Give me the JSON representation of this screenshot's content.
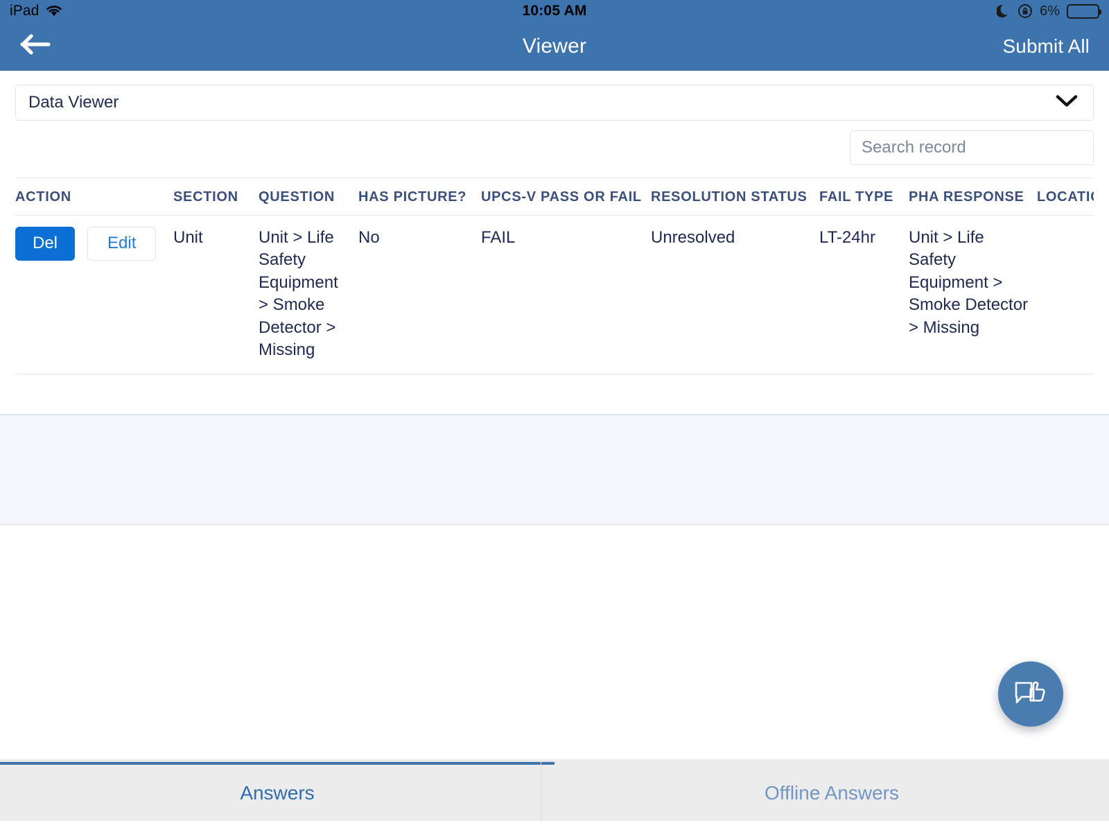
{
  "status_bar": {
    "device_label": "iPad",
    "wifi_icon": "wifi-icon",
    "time": "10:05 AM",
    "dnd_icon": "moon-icon",
    "rotation_lock_icon": "rotation-lock-icon",
    "battery_percent": "6%",
    "battery_level": 6,
    "battery_color": "#f9553f"
  },
  "nav_bar": {
    "back_icon": "arrow-left-icon",
    "title": "Viewer",
    "action_label": "Submit All",
    "background_color": "#3d74ad"
  },
  "viewer_select": {
    "value": "Data Viewer",
    "chevron_icon": "chevron-down-icon"
  },
  "search": {
    "value": "",
    "placeholder": "Search record"
  },
  "table": {
    "columns": [
      "ACTION",
      "SECTION",
      "QUESTION",
      "HAS PICTURE?",
      "UPCS-V PASS OR FAIL",
      "RESOLUTION STATUS",
      "FAIL TYPE",
      "PHA RESPONSE",
      "LOCATION"
    ],
    "rows": [
      {
        "delete_label": "Del",
        "edit_label": "Edit",
        "section": "Unit",
        "question": "Unit > Life Safety Equipment > Smoke Detector > Missing",
        "has_picture": "No",
        "upcsv_pass_or_fail": "FAIL",
        "resolution_status": "Unresolved",
        "fail_type": "LT-24hr",
        "pha_response": "Unit > Life Safety Equipment > Smoke Detector > Missing",
        "location": ""
      }
    ]
  },
  "fab": {
    "icon": "feedback-thumbs-up-icon",
    "color": "#4a7cb0"
  },
  "tab_bar": {
    "tabs": [
      {
        "label": "Answers",
        "active": true
      },
      {
        "label": "Offline Answers",
        "active": false
      }
    ]
  }
}
